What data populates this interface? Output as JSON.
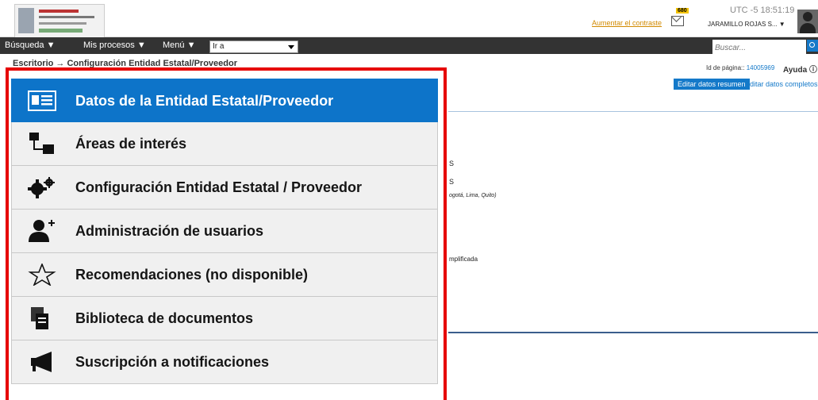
{
  "header": {
    "contrast_link": "Aumentar el contraste",
    "mail_count": "680",
    "timezone": "UTC -5 18:51:19",
    "user_name": "JARAMILLO ROJAS S... ▼"
  },
  "navbar": {
    "items": [
      "Búsqueda ▼",
      "Mis procesos ▼",
      "Menú ▼"
    ],
    "goto_value": "Ir a",
    "search_placeholder": "Buscar..."
  },
  "page": {
    "breadcrumb": "Escritorio → Configuración Entidad Estatal/Proveedor",
    "page_id_label": "Id de página:: ",
    "page_id_value": "14005969",
    "help": "Ayuda ⓘ",
    "edit_summary": "Editar datos resumen",
    "edit_full": "Editar datos completos"
  },
  "background_text": [
    "S",
    "S",
    "ogotá, Lima, Quito)",
    "mplificada"
  ],
  "menu": {
    "items": [
      {
        "label": "Datos de la Entidad Estatal/Proveedor",
        "icon": "id-card-icon",
        "active": true
      },
      {
        "label": "Áreas de interés",
        "icon": "hierarchy-icon",
        "active": false
      },
      {
        "label": "Configuración Entidad Estatal / Proveedor",
        "icon": "gears-icon",
        "active": false
      },
      {
        "label": "Administración de usuarios",
        "icon": "add-user-icon",
        "active": false
      },
      {
        "label": "Recomendaciones (no disponible)",
        "icon": "star-icon",
        "active": false
      },
      {
        "label": "Biblioteca de documentos",
        "icon": "documents-icon",
        "active": false
      },
      {
        "label": "Suscripción a notificaciones",
        "icon": "megaphone-icon",
        "active": false
      }
    ]
  },
  "colors": {
    "accent": "#0d74c9",
    "highlight_border": "#e60000",
    "navbar": "#333333"
  }
}
